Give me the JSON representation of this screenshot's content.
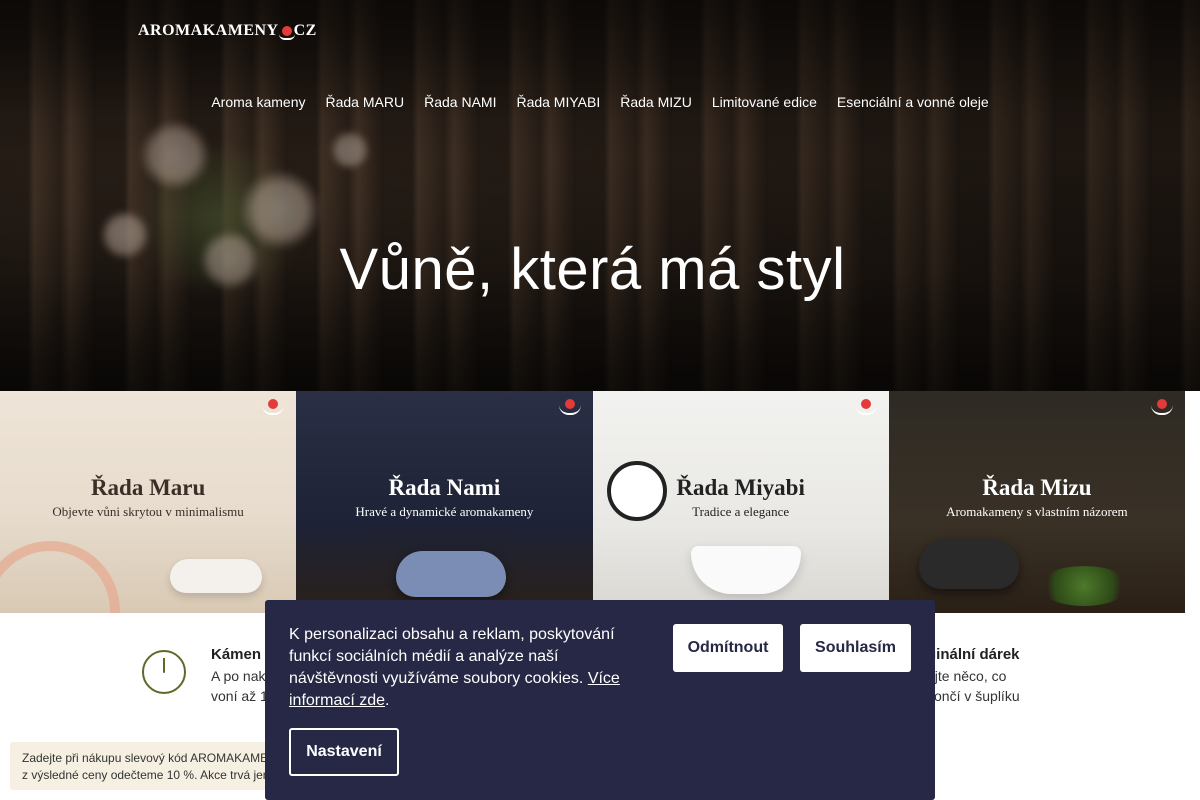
{
  "header": {
    "logo_main": "AROMAKAMENY",
    "logo_tld": "CZ",
    "icons": [
      "search-icon",
      "user-icon",
      "cart-icon"
    ],
    "icon_glyphs": [
      "",
      "",
      ""
    ]
  },
  "nav": {
    "items": [
      "Aroma kameny",
      "Řada MARU",
      "Řada NAMI",
      "Řada MIYABI",
      "Řada MIZU",
      "Limitované edice",
      "Esenciální a vonné oleje"
    ]
  },
  "hero": {
    "title": "Vůně, která má styl"
  },
  "tiles": [
    {
      "name": "Řada Maru",
      "subtitle": "Objevte vůni skrytou v minimalismu"
    },
    {
      "name": "Řada Nami",
      "subtitle": "Hravé a dynamické aromakameny"
    },
    {
      "name": "Řada Miyabi",
      "subtitle": "Tradice a elegance"
    },
    {
      "name": "Řada Mizu",
      "subtitle": "Aromakameny s vlastním názorem"
    }
  ],
  "benefits": {
    "first_title": "Kámen",
    "first_line1": "A po nak",
    "first_line2": "voní až 1",
    "last_title": "ginální dárek",
    "last_line1": "ujte něco, co",
    "last_line2": "končí v šuplíku"
  },
  "promo": {
    "line1": "Zadejte při nákupu slevový kód AROMAKAMEN",
    "line2": "z výsledné ceny odečteme 10 %. Akce trvá jen"
  },
  "cookie": {
    "text": "K personalizaci obsahu a reklam, poskytování funkcí sociálních médií a analýze naší návštěvnosti využíváme soubory cookies.",
    "link": "Více informací zde",
    "after_link": ".",
    "decline": "Odmítnout",
    "accept": "Souhlasím",
    "settings": "Nastavení"
  },
  "colors": {
    "cookie_bg": "#262845",
    "accent_red": "#e53a3a",
    "icon_green": "#5b6b2a",
    "promo_bg": "#f5f0e2"
  }
}
